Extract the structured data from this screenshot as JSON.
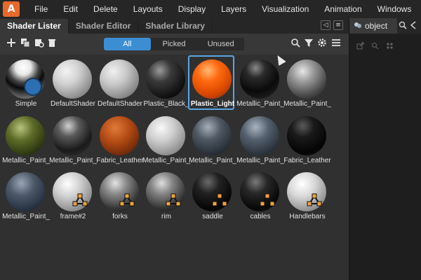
{
  "app": {
    "logo_letter": "A"
  },
  "menu": [
    "File",
    "Edit",
    "Delete",
    "Layouts",
    "Display",
    "Layers",
    "Visualization",
    "Animation",
    "Windows"
  ],
  "tabs": [
    "Shader Lister",
    "Shader Editor",
    "Shader Library"
  ],
  "tab_tools": [
    "◁",
    "≡"
  ],
  "toolbar_icons": [
    "plus-icon",
    "copy-icon",
    "graph-icon",
    "trash-icon",
    "search-icon",
    "filter-icon",
    "gear-icon",
    "menu-icon"
  ],
  "filter": {
    "options": [
      "All",
      "Picked",
      "Unused"
    ],
    "selected": "All"
  },
  "shaders": [
    {
      "label": "Simple"
    },
    {
      "label": "DefaultShader"
    },
    {
      "label": "DefaultShader"
    },
    {
      "label": "Plastic_Black_"
    },
    {
      "label": "Plastic_Light"
    },
    {
      "label": "Metallic_Paint_"
    },
    {
      "label": "Metallic_Paint_"
    },
    {
      "label": "Metallic_Paint_"
    },
    {
      "label": "Metallic_Paint_"
    },
    {
      "label": "Fabric_Leather"
    },
    {
      "label": "Metallic_Paint_"
    },
    {
      "label": "Metallic_Paint_"
    },
    {
      "label": "Metallic_Paint_"
    },
    {
      "label": "Fabric_Leather"
    },
    {
      "label": "Metallic_Paint_"
    },
    {
      "label": "frame#2"
    },
    {
      "label": "forks"
    },
    {
      "label": "rim"
    },
    {
      "label": "saddle"
    },
    {
      "label": "cables"
    },
    {
      "label": "Handlebars"
    }
  ],
  "side": {
    "tab_label": "object"
  }
}
